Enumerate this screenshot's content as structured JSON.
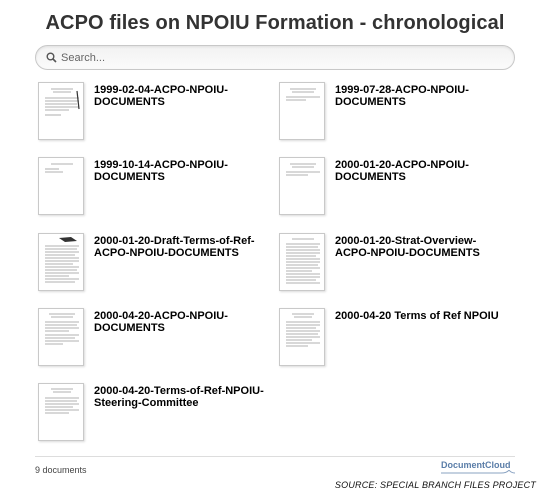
{
  "title": "ACPO files on NPOIU Formation - chronological",
  "search": {
    "placeholder": "Search..."
  },
  "documents": [
    {
      "title": "1999-02-04-ACPO-NPOIU-DOCUMENTS"
    },
    {
      "title": "1999-07-28-ACPO-NPOIU-DOCUMENTS"
    },
    {
      "title": "1999-10-14-ACPO-NPOIU-DOCUMENTS"
    },
    {
      "title": "2000-01-20-ACPO-NPOIU-DOCUMENTS"
    },
    {
      "title": "2000-01-20-Draft-Terms-of-Ref-ACPO-NPOIU-DOCUMENTS"
    },
    {
      "title": "2000-01-20-Strat-Overview-ACPO-NPOIU-DOCUMENTS"
    },
    {
      "title": "2000-04-20-ACPO-NPOIU-DOCUMENTS"
    },
    {
      "title": "2000-04-20 Terms of Ref NPOIU"
    },
    {
      "title": "2000-04-20-Terms-of-Ref-NPOIU-Steering-Committee"
    }
  ],
  "footer": {
    "count": "9 documents",
    "brand": "DocumentCloud",
    "source": "SOURCE: SPECIAL BRANCH FILES PROJECT"
  },
  "colors": {
    "brand": "#5a7da8",
    "border": "#c8c8c8"
  }
}
